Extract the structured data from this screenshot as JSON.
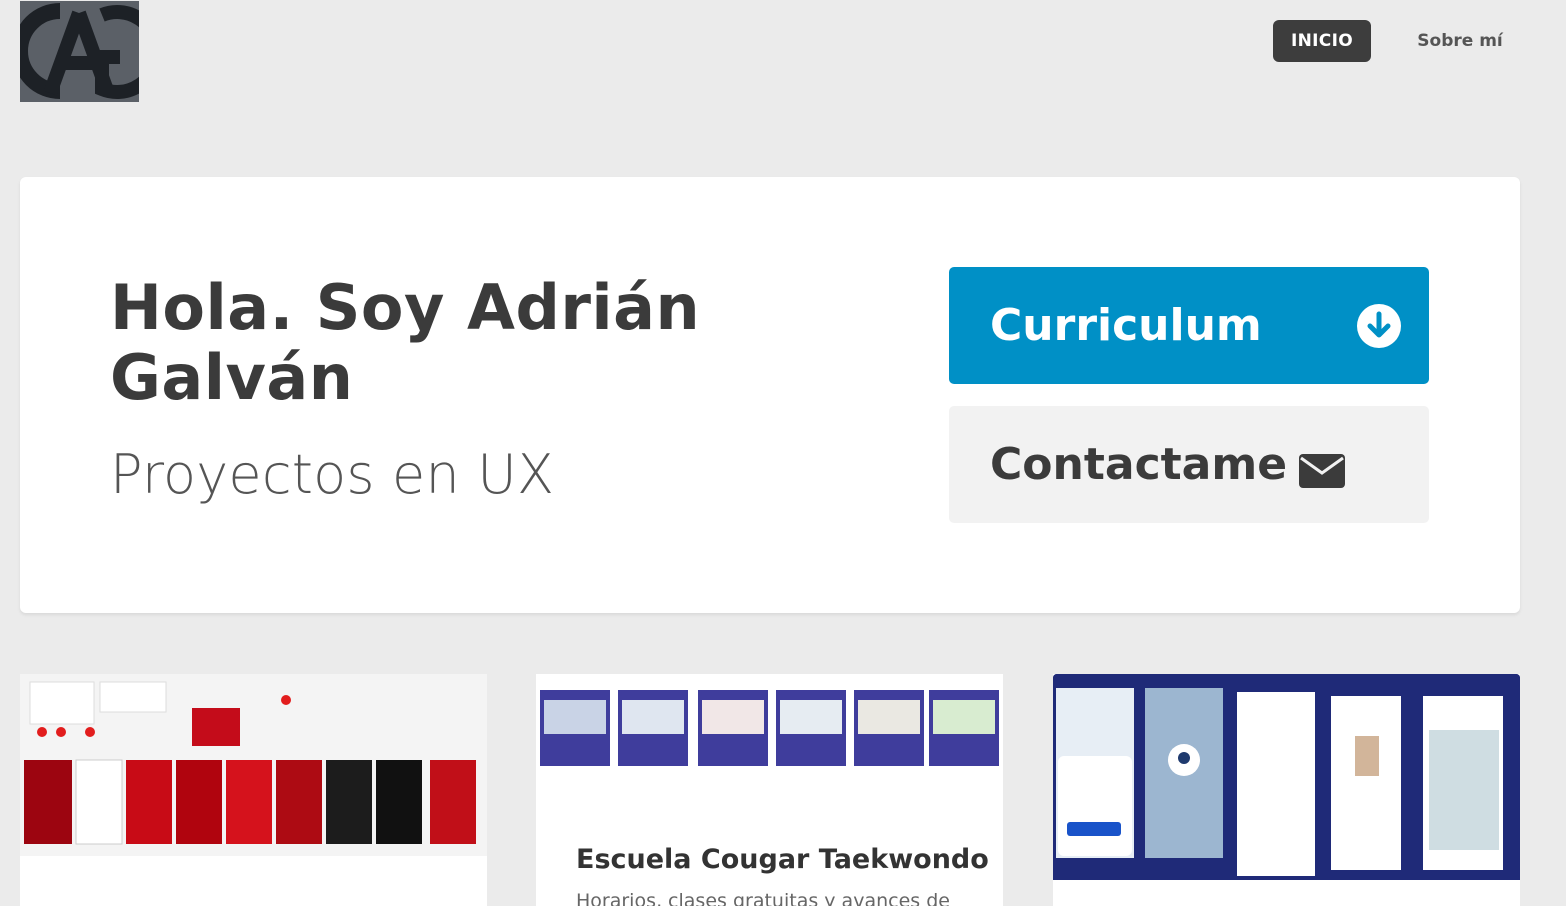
{
  "header": {
    "logo_text": "AG",
    "nav": {
      "home_label": "INICIO",
      "about_label": "Sobre mí"
    }
  },
  "hero": {
    "title": "Hola. Soy Adrián Galván",
    "subtitle": "Proyectos en UX",
    "cv_button_label": "Curriculum",
    "cv_button_icon": "download-circle-icon",
    "contact_button_label": "Contactame",
    "contact_button_icon": "envelope-icon"
  },
  "projects": [
    {
      "title": "",
      "description": "",
      "image": "pizza-app-mockups"
    },
    {
      "title": "Escuela Cougar Taekwondo",
      "description": "Horarios, clases gratuitas y avances de",
      "image": "taekwondo-site-mockups"
    },
    {
      "title": "",
      "description": "",
      "image": "doctor-search-app-mockups"
    }
  ],
  "colors": {
    "primary": "#0090c6",
    "dark": "#3d3d3d",
    "background": "#ebebeb"
  }
}
